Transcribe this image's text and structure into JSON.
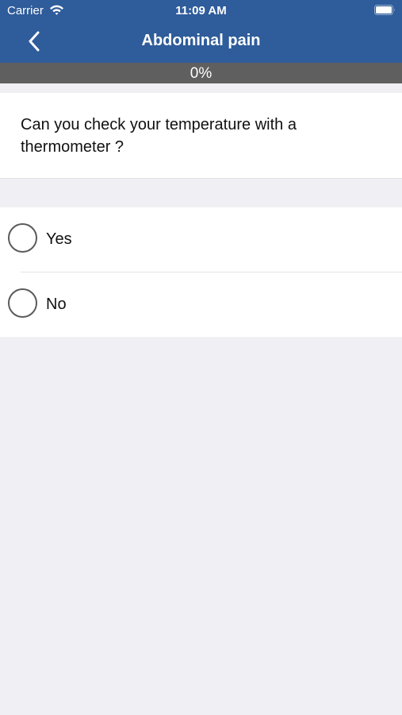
{
  "status_bar": {
    "carrier": "Carrier",
    "time": "11:09 AM",
    "icons": [
      "wifi-icon",
      "battery-icon"
    ]
  },
  "nav": {
    "title": "Abdominal pain",
    "back_icon": "chevron-left-icon"
  },
  "progress": {
    "label": "0%",
    "value": 0
  },
  "question": {
    "text": "Can you check your temperature with a thermometer ?"
  },
  "options": [
    {
      "label": "Yes",
      "selected": false
    },
    {
      "label": "No",
      "selected": false
    }
  ],
  "colors": {
    "header": "#2f5c9a",
    "progress_track": "#5f5f5f",
    "background": "#efeff4"
  }
}
